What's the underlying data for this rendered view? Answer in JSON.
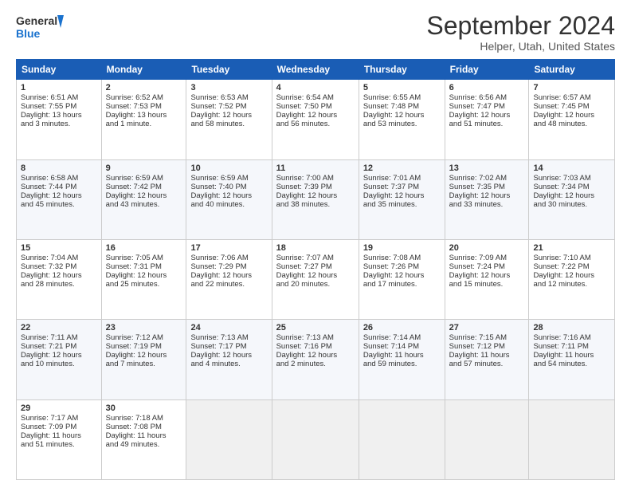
{
  "header": {
    "logo_line1": "General",
    "logo_line2": "Blue",
    "month_title": "September 2024",
    "location": "Helper, Utah, United States"
  },
  "days_of_week": [
    "Sunday",
    "Monday",
    "Tuesday",
    "Wednesday",
    "Thursday",
    "Friday",
    "Saturday"
  ],
  "weeks": [
    [
      {
        "day": "1",
        "text": "Sunrise: 6:51 AM\nSunset: 7:55 PM\nDaylight: 13 hours\nand 3 minutes."
      },
      {
        "day": "2",
        "text": "Sunrise: 6:52 AM\nSunset: 7:53 PM\nDaylight: 13 hours\nand 1 minute."
      },
      {
        "day": "3",
        "text": "Sunrise: 6:53 AM\nSunset: 7:52 PM\nDaylight: 12 hours\nand 58 minutes."
      },
      {
        "day": "4",
        "text": "Sunrise: 6:54 AM\nSunset: 7:50 PM\nDaylight: 12 hours\nand 56 minutes."
      },
      {
        "day": "5",
        "text": "Sunrise: 6:55 AM\nSunset: 7:48 PM\nDaylight: 12 hours\nand 53 minutes."
      },
      {
        "day": "6",
        "text": "Sunrise: 6:56 AM\nSunset: 7:47 PM\nDaylight: 12 hours\nand 51 minutes."
      },
      {
        "day": "7",
        "text": "Sunrise: 6:57 AM\nSunset: 7:45 PM\nDaylight: 12 hours\nand 48 minutes."
      }
    ],
    [
      {
        "day": "8",
        "text": "Sunrise: 6:58 AM\nSunset: 7:44 PM\nDaylight: 12 hours\nand 45 minutes."
      },
      {
        "day": "9",
        "text": "Sunrise: 6:59 AM\nSunset: 7:42 PM\nDaylight: 12 hours\nand 43 minutes."
      },
      {
        "day": "10",
        "text": "Sunrise: 6:59 AM\nSunset: 7:40 PM\nDaylight: 12 hours\nand 40 minutes."
      },
      {
        "day": "11",
        "text": "Sunrise: 7:00 AM\nSunset: 7:39 PM\nDaylight: 12 hours\nand 38 minutes."
      },
      {
        "day": "12",
        "text": "Sunrise: 7:01 AM\nSunset: 7:37 PM\nDaylight: 12 hours\nand 35 minutes."
      },
      {
        "day": "13",
        "text": "Sunrise: 7:02 AM\nSunset: 7:35 PM\nDaylight: 12 hours\nand 33 minutes."
      },
      {
        "day": "14",
        "text": "Sunrise: 7:03 AM\nSunset: 7:34 PM\nDaylight: 12 hours\nand 30 minutes."
      }
    ],
    [
      {
        "day": "15",
        "text": "Sunrise: 7:04 AM\nSunset: 7:32 PM\nDaylight: 12 hours\nand 28 minutes."
      },
      {
        "day": "16",
        "text": "Sunrise: 7:05 AM\nSunset: 7:31 PM\nDaylight: 12 hours\nand 25 minutes."
      },
      {
        "day": "17",
        "text": "Sunrise: 7:06 AM\nSunset: 7:29 PM\nDaylight: 12 hours\nand 22 minutes."
      },
      {
        "day": "18",
        "text": "Sunrise: 7:07 AM\nSunset: 7:27 PM\nDaylight: 12 hours\nand 20 minutes."
      },
      {
        "day": "19",
        "text": "Sunrise: 7:08 AM\nSunset: 7:26 PM\nDaylight: 12 hours\nand 17 minutes."
      },
      {
        "day": "20",
        "text": "Sunrise: 7:09 AM\nSunset: 7:24 PM\nDaylight: 12 hours\nand 15 minutes."
      },
      {
        "day": "21",
        "text": "Sunrise: 7:10 AM\nSunset: 7:22 PM\nDaylight: 12 hours\nand 12 minutes."
      }
    ],
    [
      {
        "day": "22",
        "text": "Sunrise: 7:11 AM\nSunset: 7:21 PM\nDaylight: 12 hours\nand 10 minutes."
      },
      {
        "day": "23",
        "text": "Sunrise: 7:12 AM\nSunset: 7:19 PM\nDaylight: 12 hours\nand 7 minutes."
      },
      {
        "day": "24",
        "text": "Sunrise: 7:13 AM\nSunset: 7:17 PM\nDaylight: 12 hours\nand 4 minutes."
      },
      {
        "day": "25",
        "text": "Sunrise: 7:13 AM\nSunset: 7:16 PM\nDaylight: 12 hours\nand 2 minutes."
      },
      {
        "day": "26",
        "text": "Sunrise: 7:14 AM\nSunset: 7:14 PM\nDaylight: 11 hours\nand 59 minutes."
      },
      {
        "day": "27",
        "text": "Sunrise: 7:15 AM\nSunset: 7:12 PM\nDaylight: 11 hours\nand 57 minutes."
      },
      {
        "day": "28",
        "text": "Sunrise: 7:16 AM\nSunset: 7:11 PM\nDaylight: 11 hours\nand 54 minutes."
      }
    ],
    [
      {
        "day": "29",
        "text": "Sunrise: 7:17 AM\nSunset: 7:09 PM\nDaylight: 11 hours\nand 51 minutes."
      },
      {
        "day": "30",
        "text": "Sunrise: 7:18 AM\nSunset: 7:08 PM\nDaylight: 11 hours\nand 49 minutes."
      },
      {
        "day": "",
        "text": ""
      },
      {
        "day": "",
        "text": ""
      },
      {
        "day": "",
        "text": ""
      },
      {
        "day": "",
        "text": ""
      },
      {
        "day": "",
        "text": ""
      }
    ]
  ]
}
